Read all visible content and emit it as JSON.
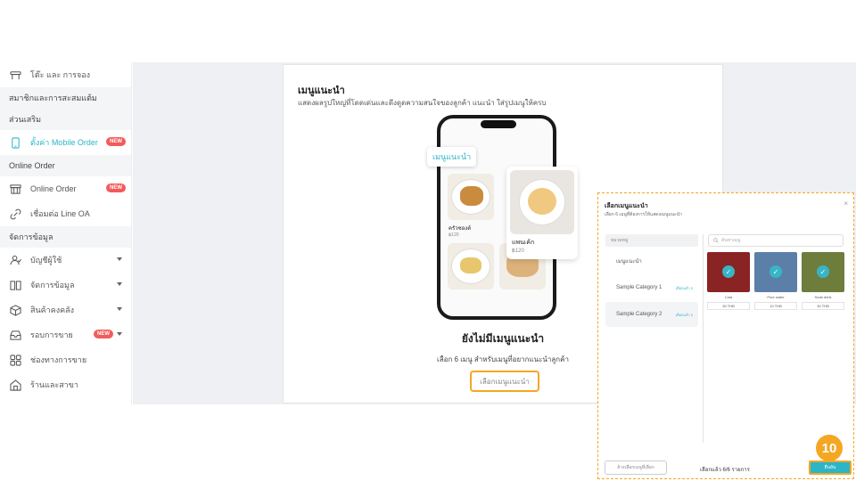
{
  "sidebar": {
    "items": [
      {
        "type": "row",
        "icon": "table-icon",
        "label": "โต๊ะ และ การจอง"
      },
      {
        "type": "section",
        "label": "สมาชิกและการสะสมแต้ม"
      },
      {
        "type": "section",
        "label": "ส่วนเสริม"
      },
      {
        "type": "row",
        "icon": "tablet-icon",
        "label": "ตั้งค่า Mobile Order",
        "badge": "NEW",
        "active": true
      },
      {
        "type": "section",
        "label": "Online Order"
      },
      {
        "type": "row",
        "icon": "store-icon",
        "label": "Online Order",
        "badge": "NEW"
      },
      {
        "type": "row",
        "icon": "link-icon",
        "label": "เชื่อมต่อ Line OA"
      },
      {
        "type": "section",
        "label": "จัดการข้อมูล"
      },
      {
        "type": "row",
        "icon": "user-icon",
        "label": "บัญชีผู้ใช้",
        "chevron": true
      },
      {
        "type": "row",
        "icon": "book-icon",
        "label": "จัดการข้อมูล",
        "chevron": true
      },
      {
        "type": "row",
        "icon": "box-icon",
        "label": "สินค้าคงคลัง",
        "chevron": true
      },
      {
        "type": "row",
        "icon": "inbox-icon",
        "label": "รอบการขาย",
        "badge": "NEW",
        "chevron": true
      },
      {
        "type": "row",
        "icon": "grid-icon",
        "label": "ช่องทางการขาย"
      },
      {
        "type": "row",
        "icon": "home-icon",
        "label": "ร้านและสาขา"
      }
    ]
  },
  "card": {
    "title": "เมนูแนะนำ",
    "subtitle": "แสดงผลรูปใหญ่ที่โดดเด่นและดึงดูดความสนใจของลูกค้า แนะนำ ใส่รูปเมนูให้ครบ",
    "rec_tag": "เมนูแนะนำ",
    "phone_item1": "ครัวซองต์",
    "phone_item1_price": "฿120",
    "phone_item2": "แพนเค้ก",
    "phone_item2_price": "฿120",
    "empty_title": "ยังไม่มีเมนูแนะนำ",
    "empty_sub": "เลือก 6 เมนู สำหรับเมนูที่อยากแนะนำลูกค้า",
    "select_button": "เลือกเมนูแนะนำ"
  },
  "modal": {
    "title": "เลือกเมนูแนะนำ",
    "subtitle": "เลือก 6 เมนูที่ต้องการให้แสดงเมนูแนะนำ",
    "close": "×",
    "category_header": "หมวดหมู่",
    "categories": [
      {
        "label": "เมนูแนะนำ",
        "count": ""
      },
      {
        "label": "Sample Category 1",
        "count": "เลือกแล้ว 3"
      },
      {
        "label": "Sample Category 2",
        "count": "เลือกแล้ว 3"
      }
    ],
    "search_placeholder": "ค้นหาเมนู",
    "products": [
      {
        "name": "Cola",
        "price": "30 THB",
        "color": "#8a2323"
      },
      {
        "name": "Pure water",
        "price": "10 THB",
        "color": "#5b7fa8"
      },
      {
        "name": "Soda drink",
        "price": "30 THB",
        "color": "#6e7c3c"
      }
    ],
    "reset_button": "ล้างเลือกเมนูที่เลือก",
    "selected_count": "เลือกแล้ว 6/6 รายการ",
    "confirm_button": "ยืนยัน"
  },
  "step_badge": "10",
  "colors": {
    "accent": "#2bb5c8",
    "highlight": "#f5a623",
    "badge": "#f25b5b"
  }
}
